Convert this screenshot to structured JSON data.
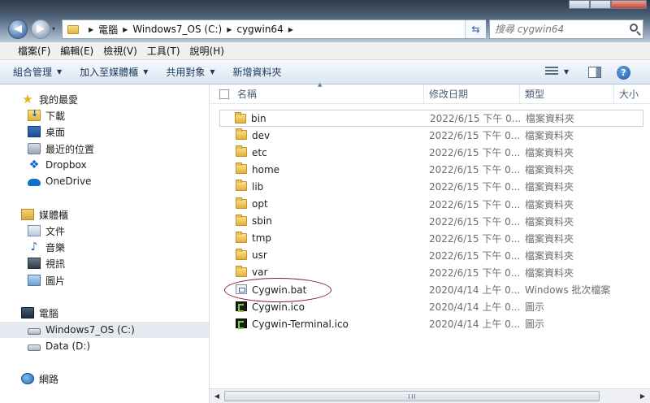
{
  "window": {
    "nav": {
      "back_label": "◀",
      "forward_label": "▶",
      "dropdown": "▾"
    },
    "breadcrumb": [
      "電腦",
      "Windows7_OS (C:)",
      "cygwin64"
    ],
    "search": {
      "placeholder": "搜尋 cygwin64"
    }
  },
  "menubar": [
    "檔案(F)",
    "編輯(E)",
    "檢視(V)",
    "工具(T)",
    "說明(H)"
  ],
  "toolbar": {
    "organize": "組合管理",
    "add_to_library": "加入至媒體櫃",
    "share_with": "共用對象",
    "new_folder": "新增資料夾",
    "help": "?"
  },
  "sidebar": {
    "favorites": {
      "label": "我的最愛",
      "items": [
        "下載",
        "桌面",
        "最近的位置",
        "Dropbox",
        "OneDrive"
      ]
    },
    "libraries": {
      "label": "媒體櫃",
      "items": [
        "文件",
        "音樂",
        "視訊",
        "圖片"
      ]
    },
    "computer": {
      "label": "電腦",
      "items": [
        "Windows7_OS (C:)",
        "Data (D:)"
      ],
      "selected": "Windows7_OS (C:)"
    },
    "network": {
      "label": "網路"
    }
  },
  "columns": {
    "name": "名稱",
    "date": "修改日期",
    "type": "類型",
    "size": "大小"
  },
  "files": [
    {
      "name": "bin",
      "date": "2022/6/15 下午 0...",
      "type": "檔案資料夾",
      "kind": "folder"
    },
    {
      "name": "dev",
      "date": "2022/6/15 下午 0...",
      "type": "檔案資料夾",
      "kind": "folder"
    },
    {
      "name": "etc",
      "date": "2022/6/15 下午 0...",
      "type": "檔案資料夾",
      "kind": "folder"
    },
    {
      "name": "home",
      "date": "2022/6/15 下午 0...",
      "type": "檔案資料夾",
      "kind": "folder"
    },
    {
      "name": "lib",
      "date": "2022/6/15 下午 0...",
      "type": "檔案資料夾",
      "kind": "folder"
    },
    {
      "name": "opt",
      "date": "2022/6/15 下午 0...",
      "type": "檔案資料夾",
      "kind": "folder"
    },
    {
      "name": "sbin",
      "date": "2022/6/15 下午 0...",
      "type": "檔案資料夾",
      "kind": "folder"
    },
    {
      "name": "tmp",
      "date": "2022/6/15 下午 0...",
      "type": "檔案資料夾",
      "kind": "folder"
    },
    {
      "name": "usr",
      "date": "2022/6/15 下午 0...",
      "type": "檔案資料夾",
      "kind": "folder"
    },
    {
      "name": "var",
      "date": "2022/6/15 下午 0...",
      "type": "檔案資料夾",
      "kind": "folder"
    },
    {
      "name": "Cygwin.bat",
      "date": "2020/4/14 上午 0...",
      "type": "Windows 批次檔案",
      "kind": "bat"
    },
    {
      "name": "Cygwin.ico",
      "date": "2020/4/14 上午 0...",
      "type": "圖示",
      "kind": "ico"
    },
    {
      "name": "Cygwin-Terminal.ico",
      "date": "2020/4/14 上午 0...",
      "type": "圖示",
      "kind": "ico"
    }
  ],
  "colors": {
    "annotation_ellipse": "#8b1a2a",
    "accent": "#1e395b"
  }
}
